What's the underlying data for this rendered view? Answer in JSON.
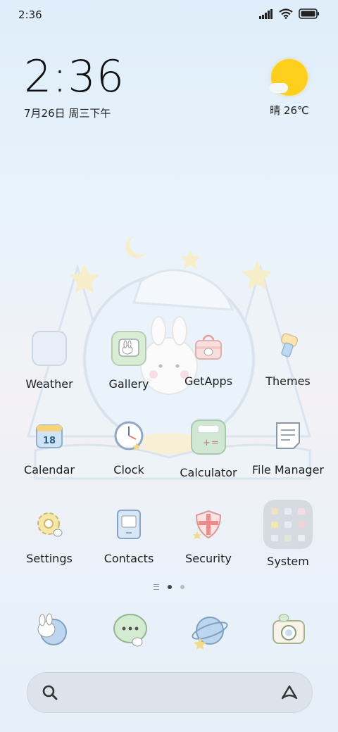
{
  "status_bar": {
    "time": "2:36"
  },
  "clock_widget": {
    "time": "2:36",
    "date": "7月26日 周三下午"
  },
  "weather_widget": {
    "text": "晴 26℃"
  },
  "apps": [
    {
      "label": "Weather"
    },
    {
      "label": "Gallery"
    },
    {
      "label": "GetApps"
    },
    {
      "label": "Themes"
    },
    {
      "label": "Calendar"
    },
    {
      "label": "Clock"
    },
    {
      "label": "Calculator"
    },
    {
      "label": "File Manager"
    },
    {
      "label": "Settings"
    },
    {
      "label": "Contacts"
    },
    {
      "label": "Security"
    },
    {
      "label": "System"
    }
  ],
  "calendar_icon_day": "18",
  "page_indicator": {
    "pages": 2,
    "current": 1
  },
  "dock": [
    "phone-app-icon",
    "messages-app-icon",
    "browser-app-icon",
    "camera-app-icon"
  ],
  "search_bar": {
    "left_icon": "search-icon",
    "right_icon": "assistant-icon"
  },
  "colors": {
    "sun": "#ffcf1e",
    "background_top": "#dfeefa",
    "search_bar": "#dde3ea"
  }
}
